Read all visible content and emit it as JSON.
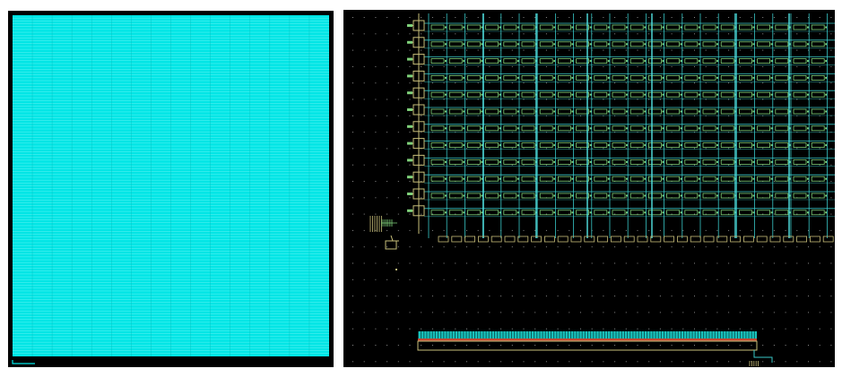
{
  "layout_views": [
    {
      "view": "full-array-overview",
      "background_color": "#000000",
      "fill_color": "#00e5e5",
      "line_color": "#6ff5f5",
      "row_count": 120,
      "column_count": 16
    },
    {
      "view": "zoomed-array-corner",
      "background_color": "#000000",
      "grid_dot_color": "#8a8a8a",
      "wire_color": "#38c7c7",
      "cell_color": "#7fd17a",
      "decoder_color": "#c8bf7a",
      "cell_rows": 12,
      "cell_columns": 22,
      "driver_row_cells": 31,
      "bus_fill_color": "#18c4bd",
      "bus_stripe_color": "#c24a34",
      "bus_teeth": 120
    }
  ],
  "colors": {
    "page_background": "#ffffff"
  }
}
